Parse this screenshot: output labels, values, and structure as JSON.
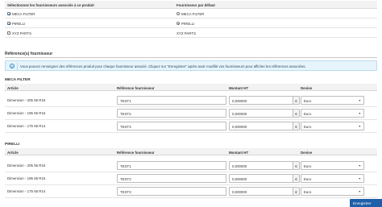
{
  "supplier_selection": {
    "col_suppliers": "Sélectionnez les fournisseurs associés à ce produit",
    "col_default": "Fournisseur par défaut",
    "rows": [
      {
        "name": "MECA FILTER",
        "checked": true,
        "default_label": "MECA FILTER",
        "is_default": false,
        "has_radio": true
      },
      {
        "name": "PIRELLI",
        "checked": true,
        "default_label": "PIRELLI",
        "is_default": true,
        "has_radio": true
      },
      {
        "name": "XYZ PARTS",
        "checked": false,
        "default_label": "XYZ PARTS",
        "is_default": false,
        "has_radio": false
      }
    ]
  },
  "references": {
    "title": "Référence(s) fournisseur",
    "info_text": "Vous pouvez renseigner des références produit pour chaque fournisseur associé. Cliquez sur \"Enregistrer\" après avoir modifié vos fournisseurs pour afficher les références associées.",
    "columns": {
      "article": "Article",
      "reference": "Référence fournisseur",
      "amount": "Montant HT",
      "currency": "Devise"
    },
    "groups": [
      {
        "supplier": "MECA FILTER",
        "rows": [
          {
            "article": "Dimension - 205 55 R16",
            "reference": "TEST1",
            "amount": "0,000000",
            "currency_symbol": "€",
            "currency": "Euro"
          },
          {
            "article": "Dimension - 195 65 R15",
            "reference": "TEST2",
            "amount": "0,000000",
            "currency_symbol": "€",
            "currency": "Euro"
          },
          {
            "article": "Dimension - 175 65 R14",
            "reference": "TEST3",
            "amount": "0,000000",
            "currency_symbol": "€",
            "currency": "Euro"
          }
        ]
      },
      {
        "supplier": "PIRELLI",
        "rows": [
          {
            "article": "Dimension - 205 55 R16",
            "reference": "TEST1",
            "amount": "0,000000",
            "currency_symbol": "€",
            "currency": "Euro"
          },
          {
            "article": "Dimension - 195 65 R15",
            "reference": "TEST2",
            "amount": "0,000000",
            "currency_symbol": "€",
            "currency": "Euro"
          },
          {
            "article": "Dimension - 175 65 R14",
            "reference": "TEST3",
            "amount": "0,000000",
            "currency_symbol": "€",
            "currency": "Euro"
          }
        ]
      }
    ]
  },
  "save_label": "Enregistrer",
  "icons": {
    "info": "info-icon",
    "caret": "chevron-down-icon"
  },
  "colors": {
    "accent": "#1e5fa8",
    "info_bg": "#e7f4fb",
    "info_border": "#b7dcef"
  }
}
